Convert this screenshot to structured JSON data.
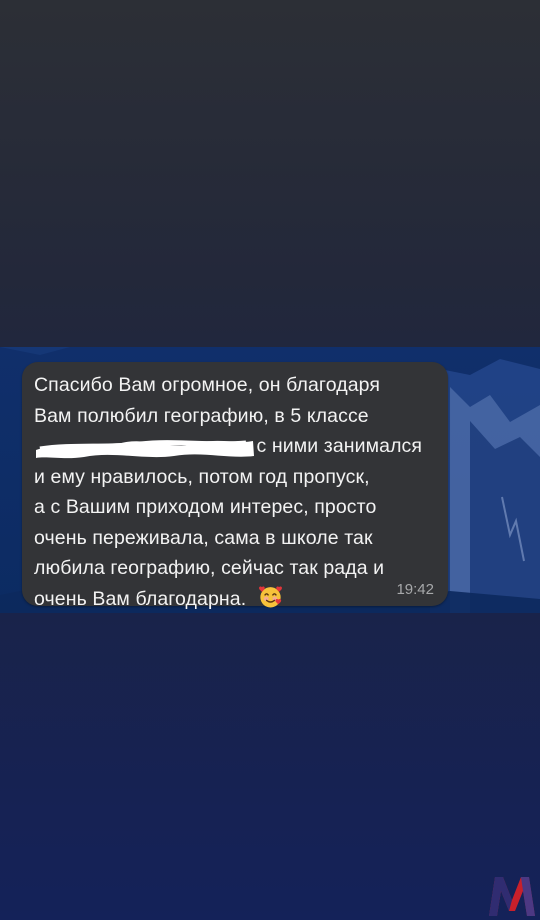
{
  "message": {
    "lines": [
      "Спасибо Вам огромное, он благодаря",
      "Вам полюбил географию, в 5 классе",
      "с ними занимался",
      "и ему нравилось, потом год пропуск,",
      "а с Вашим приходом интерес, просто",
      "очень переживала, сама в школе так",
      "любила географию, сейчас так рада и",
      "очень Вам благодарна."
    ],
    "time": "19:42",
    "emoji": "smiling-face-with-hearts-icon"
  },
  "colors": {
    "bubble": "#333437",
    "text": "#f3f3f3",
    "timestamp": "#a7a8aa",
    "logo_red": "#c8202b",
    "logo_blue": "#1f2d79"
  }
}
